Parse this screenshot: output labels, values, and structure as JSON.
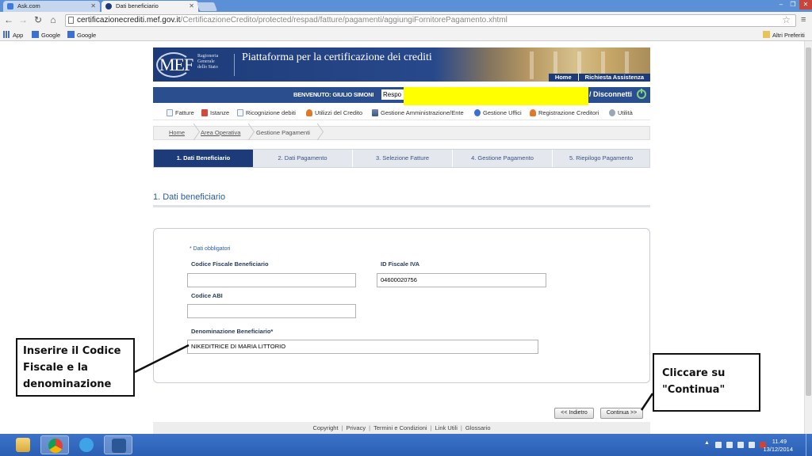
{
  "browser": {
    "tabs": [
      {
        "label": "Ask.com",
        "active": false
      },
      {
        "label": "Dati beneficiario",
        "active": true
      }
    ],
    "address": {
      "host": "certificazionecrediti.mef.gov.it",
      "path": "/CertificazioneCredito/protected/respad/fatture/pagamenti/aggiungiFornitorePagamento.xhtml"
    },
    "bookmarks": [
      "App",
      "Google",
      "Google"
    ],
    "other_bookmarks": "Altri Preferiti"
  },
  "header": {
    "logo": "MEF",
    "org_lines": [
      "Ragioneria",
      "Generale",
      "dello Stato"
    ],
    "platform_title": "Piattaforma per la certificazione dei crediti",
    "nav": [
      "Home",
      "Richiesta Assistenza"
    ],
    "welcome": "BENVENUTO: GIULIO SIMONI",
    "profile_value": "Respo",
    "disconnect": "/ Disconnetti"
  },
  "main_nav": [
    "Fatture",
    "Istanze",
    "Ricognizione debiti",
    "Utilizzi del Credito",
    "Gestione Amministrazione/Ente",
    "Gestione Uffici",
    "Registrazione Creditori",
    "Utilità"
  ],
  "breadcrumb": [
    "Home",
    "Area Operativa",
    "Gestione Pagamenti"
  ],
  "steps": [
    "1. Dati Beneficiario",
    "2. Dati Pagamento",
    "3. Selezione Fatture",
    "4. Gestione Pagamento",
    "5. Riepilogo Pagamento"
  ],
  "section_title": "1. Dati beneficiario",
  "form": {
    "required_note": "* Dati obbligatori",
    "codice_fiscale_label": "Codice Fiscale Beneficiario",
    "codice_fiscale_value": "",
    "id_fiscale_label": "ID Fiscale IVA",
    "id_fiscale_value": "04600020756",
    "abi_label": "Codice ABI",
    "abi_value": "",
    "denominazione_label": "Denominazione Beneficiario*",
    "denominazione_value": "NIKEDITRICE DI MARIA LITTORIO"
  },
  "buttons": {
    "back": "<< Indietro",
    "next": "Continua >>"
  },
  "footer": [
    "Copyright",
    "Privacy",
    "Termini e Condizioni",
    "Link Utili",
    "Glossario"
  ],
  "callouts": {
    "left_lines": [
      "Inserire il Codice",
      "Fiscale e la",
      "denominazione"
    ],
    "right_lines": [
      "Cliccare su",
      "\"Continua\""
    ]
  },
  "taskbar": {
    "time": "11.49",
    "date": "13/12/2014"
  },
  "colors": {
    "brand_navy": "#1d3b78",
    "welcome_bar": "#2b4f8e",
    "redaction": "#ffff00",
    "taskbar": "#2a5fb3"
  }
}
